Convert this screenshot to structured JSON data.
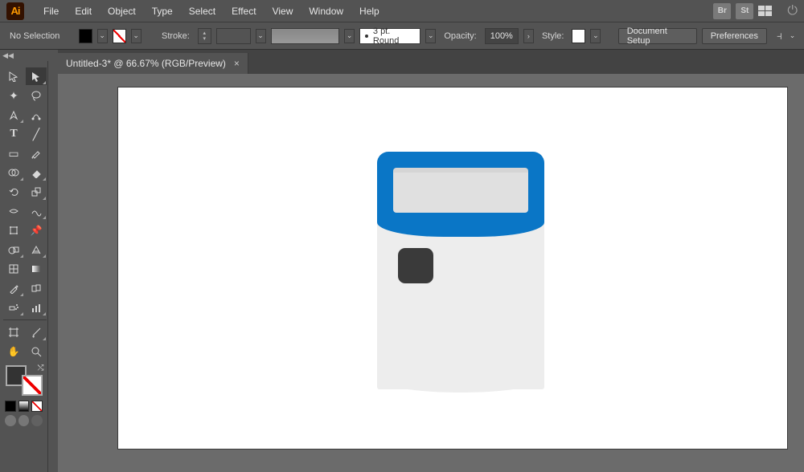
{
  "app": {
    "icon_text": "Ai"
  },
  "menus": {
    "file": "File",
    "edit": "Edit",
    "object": "Object",
    "type": "Type",
    "select": "Select",
    "effect": "Effect",
    "view": "View",
    "window": "Window",
    "help": "Help"
  },
  "menubar_right": {
    "br": "Br",
    "st": "St"
  },
  "controlbar": {
    "selection_status": "No Selection",
    "stroke_label": "Stroke:",
    "brush_label": "3 pt. Round",
    "opacity_label": "Opacity:",
    "opacity_value": "100%",
    "style_label": "Style:",
    "doc_setup": "Document Setup",
    "preferences": "Preferences"
  },
  "tabs": {
    "active": {
      "title": "Untitled-3* @ 66.67% (RGB/Preview)"
    }
  },
  "collapse_glyph": "◀◀",
  "tools": {
    "selection": "▸",
    "direct_selection": "▸",
    "magic_wand": "✦",
    "lasso": "◉",
    "pen": "✒",
    "curvature": "✎",
    "type": "T",
    "line": "╱",
    "rectangle": "▭",
    "paintbrush": "🖌",
    "shape_builder": "◔",
    "eraser": "◢",
    "rotate": "⟳",
    "scale": "⤢",
    "width": "▷",
    "warp": "≋",
    "free_transform": "⯐",
    "puppet": "📌",
    "mesh": "▦",
    "gradient": "▯",
    "eyedropper": "ℐ",
    "blend": "◫",
    "symbol_sprayer": "✱",
    "graph": "⫿",
    "artboard": "▢",
    "slice": "✂",
    "hand": "✋",
    "zoom": "🔍"
  }
}
